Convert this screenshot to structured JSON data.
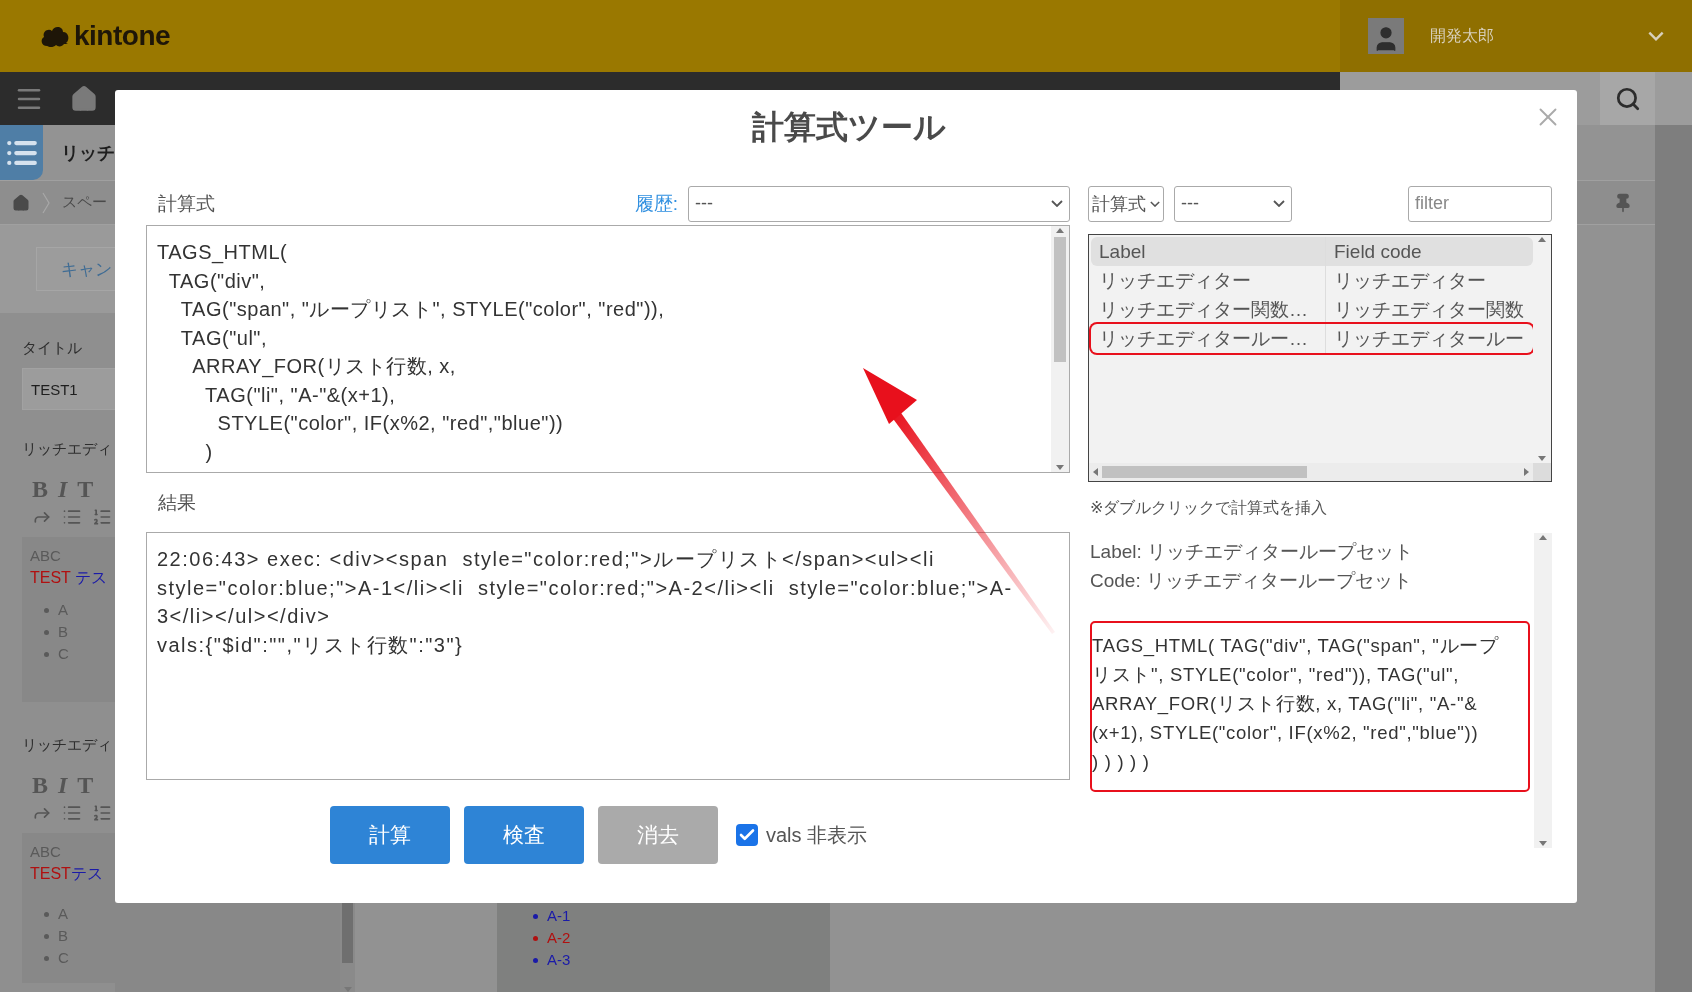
{
  "header": {
    "logo": "kintone",
    "user_name": "開発太郎"
  },
  "background": {
    "app_title": "リッチ",
    "breadcrumb": "スペー",
    "cancel_button": "キャン",
    "title_field": {
      "label": "タイトル",
      "value": "TEST1"
    },
    "editors": [
      {
        "label": "リッチエディ",
        "toolbar": [
          "B",
          "I",
          "T"
        ],
        "caption": "ABC",
        "red_text": "TEST",
        "blue_text": "テス",
        "gap": true,
        "items": [
          "A",
          "B",
          "C"
        ]
      },
      {
        "label": "リッチエディ",
        "toolbar": [
          "B",
          "I",
          "T"
        ],
        "caption": "ABC",
        "red_text": "TEST",
        "blue_text": "テス",
        "gap": false,
        "items": [
          "A",
          "B",
          "C"
        ]
      }
    ],
    "preview_list": [
      {
        "text": "A-1",
        "color": "#1a1aa8"
      },
      {
        "text": "A-2",
        "color": "#b01010"
      },
      {
        "text": "A-3",
        "color": "#1a1aa8"
      }
    ]
  },
  "dialog": {
    "title": "計算式ツール",
    "formula": {
      "label": "計算式",
      "history_label": "履歴:",
      "history_value": "---",
      "lines": [
        "TAGS_HTML(",
        "  TAG(\"div\",",
        "    TAG(\"span\", \"ループリスト\", STYLE(\"color\", \"red\")),",
        "    TAG(\"ul\",",
        "      ARRAY_FOR(リスト行数, x,",
        "        TAG(\"li\", \"A-\"&(x+1),",
        "          STYLE(\"color\", IF(x%2, \"red\",\"blue\"))",
        "        )"
      ]
    },
    "result": {
      "label": "結果",
      "lines": [
        "22:06:43> exec: <div><span  style=\"color:red;\">ループリスト</span><ul><li",
        "style=\"color:blue;\">A-1</li><li  style=\"color:red;\">A-2</li><li  style=\"color:blue;\">A-",
        "3</li></ul></div>",
        "vals:{\"$id\":\"\",\"リスト行数\":\"3\"}"
      ]
    },
    "buttons": [
      {
        "label": "計算",
        "disabled": false
      },
      {
        "label": "検査",
        "disabled": false
      },
      {
        "label": "消去",
        "disabled": true
      }
    ],
    "hide_vals": {
      "label": "vals 非表示",
      "checked": true
    },
    "type_select": "計算式",
    "field_select": "---",
    "filter": {
      "placeholder": "filter"
    },
    "table": {
      "columns": [
        "Label",
        "Field code"
      ],
      "rows": [
        {
          "label": "リッチエディター",
          "code": "リッチエディター",
          "selected": false
        },
        {
          "label": "リッチエディター関数…",
          "code": "リッチエディター関数",
          "selected": false
        },
        {
          "label": "リッチエディタールー…",
          "code": "リッチエディタールー",
          "selected": true
        }
      ]
    },
    "note": "※ダブルクリックで計算式を挿入",
    "detail": {
      "label_line": "Label: リッチエディターループセット",
      "code_line": "Code: リッチエディターループセット",
      "formula_lines": [
        "TAGS_HTML( TAG(\"div\", TAG(\"span\", \"ループ",
        "リスト\", STYLE(\"color\", \"red\")), TAG(\"ul\",",
        "ARRAY_FOR(リスト行数, x, TAG(\"li\", \"A-\"&",
        "(x+1), STYLE(\"color\", IF(x%2, \"red\",\"blue\"))",
        ") ) ) ) )"
      ]
    }
  }
}
